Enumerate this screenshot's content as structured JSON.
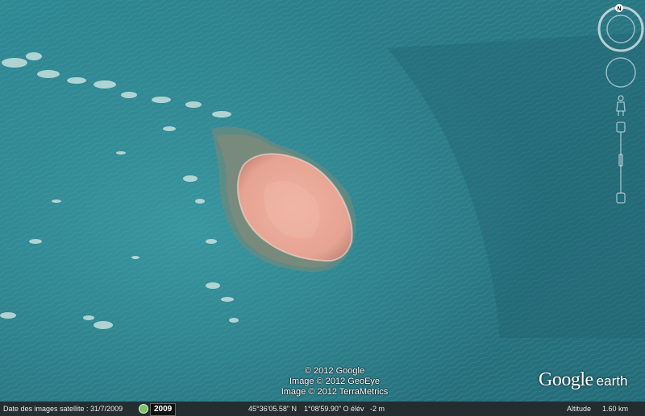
{
  "credits": [
    "© 2012 Google",
    "Image © 2012 GeoEye",
    "Image © 2012 TerraMetrics"
  ],
  "logo": {
    "google": "Google",
    "earth": "earth"
  },
  "status_bar": {
    "imagery_date": "Date des images satellite : 31/7/2009",
    "year": "2009",
    "latitude": "45°36'05.58\" N",
    "longitude": "1°08'59.90\" O",
    "elevation": "élév   -2 m",
    "altitude_label": "Altitude",
    "altitude_value": "1.60 km"
  },
  "navigation": {
    "north_label": "N",
    "icons": [
      "compass-ring-icon",
      "look-joystick-icon",
      "street-view-pegman-icon",
      "zoom-slider-icon"
    ]
  },
  "colors": {
    "sea": "#2b7480",
    "sand": "#e9a99a",
    "reef": "#6b8a80",
    "surf": "#d9ece8"
  }
}
